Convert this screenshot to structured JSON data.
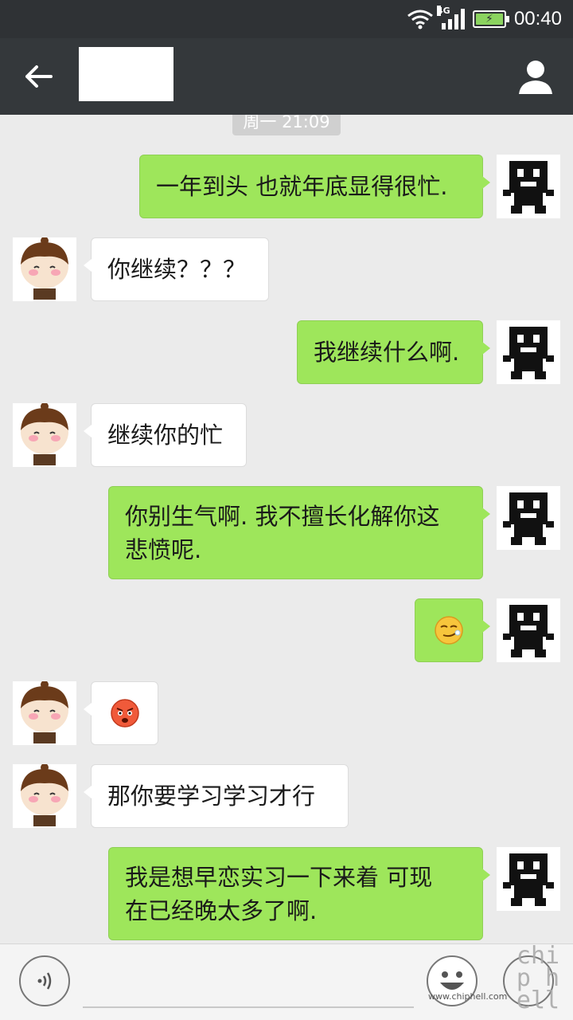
{
  "status_bar": {
    "network": "4G",
    "time": "00:40"
  },
  "chat": {
    "timestamp": "周一 21:09",
    "messages": [
      {
        "sender": "me",
        "text": "一年到头 也就年底显得很忙."
      },
      {
        "sender": "them",
        "text": "你继续？？？"
      },
      {
        "sender": "me",
        "text": "我继续什么啊."
      },
      {
        "sender": "them",
        "text": "继续你的忙"
      },
      {
        "sender": "me",
        "line1": "你别生气啊. 我不擅长化解你这",
        "line2": "悲愤呢."
      },
      {
        "sender": "me",
        "emoji": "smirk-emoji"
      },
      {
        "sender": "them",
        "emoji": "angry-face-emoji"
      },
      {
        "sender": "them",
        "text": "那你要学习学习才行"
      },
      {
        "sender": "me",
        "line1": "我是想早恋实习一下来着 可现",
        "line2": "在已经晚太多了啊."
      }
    ]
  },
  "input": {
    "placeholder": ""
  },
  "watermark": {
    "site": "www.chiphell.com",
    "logo": "chip hell"
  },
  "colors": {
    "my_bubble": "#9ee65b",
    "their_bubble": "#ffffff",
    "background": "#ebebeb",
    "title_bar": "#34383b"
  }
}
